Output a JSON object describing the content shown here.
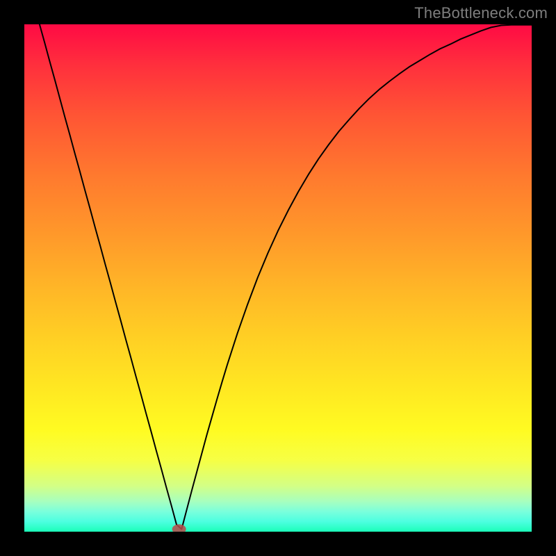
{
  "watermark": "TheBottleneck.com",
  "chart_data": {
    "type": "line",
    "title": "",
    "xlabel": "",
    "ylabel": "",
    "xlim": [
      0,
      100
    ],
    "ylim": [
      0,
      100
    ],
    "x": [
      3,
      4,
      5,
      6,
      7,
      8,
      9,
      10,
      11,
      12,
      13,
      14,
      15,
      16,
      17,
      18,
      19,
      20,
      21,
      22,
      23,
      24,
      25,
      26,
      27,
      28,
      29,
      30,
      31,
      32,
      33,
      34,
      35,
      36,
      37,
      38,
      39,
      40,
      42,
      44,
      46,
      48,
      50,
      52,
      54,
      56,
      58,
      60,
      62,
      64,
      66,
      68,
      70,
      72,
      74,
      76,
      78,
      80,
      82,
      84,
      86,
      88,
      90,
      92,
      94,
      96,
      98,
      100
    ],
    "y": [
      100,
      96.4,
      92.7,
      89.1,
      85.4,
      81.7,
      78.1,
      74.4,
      70.8,
      67.1,
      63.5,
      59.8,
      56.2,
      52.5,
      48.9,
      45.2,
      41.6,
      37.9,
      34.3,
      30.6,
      27.0,
      23.3,
      19.7,
      16.0,
      12.4,
      8.7,
      5.1,
      1.4,
      0.5,
      4.3,
      8.1,
      11.8,
      15.5,
      19.2,
      22.7,
      26.2,
      29.6,
      32.9,
      39.1,
      44.8,
      50.1,
      54.9,
      59.3,
      63.3,
      67.0,
      70.4,
      73.5,
      76.3,
      78.9,
      81.2,
      83.4,
      85.4,
      87.2,
      88.8,
      90.3,
      91.7,
      92.9,
      94.1,
      95.2,
      96.1,
      97.1,
      97.9,
      98.7,
      99.4,
      99.8,
      99.9,
      99.9,
      99.9
    ],
    "minimum_marker": {
      "x": 30.5,
      "y": 0.5
    },
    "background_gradient": [
      "#ff0a44",
      "#ffd024",
      "#fffb22",
      "#1bffb9"
    ]
  }
}
